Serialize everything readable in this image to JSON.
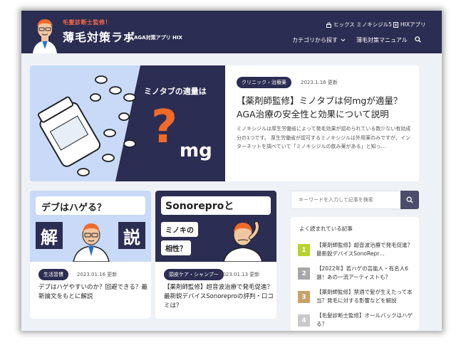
{
  "header": {
    "logo_sub": "毛髪診断士監修！",
    "logo_main": "薄毛対策ラボ",
    "logo_by": "by AGA対策アプリ HIX",
    "top_links": [
      {
        "label": "ヒックス ミノキシジル5",
        "icon": "lock-icon"
      },
      {
        "label": "HIXアプリ",
        "icon": "document-icon"
      }
    ],
    "nav": [
      {
        "label": "カテゴリから探す",
        "icon": "chevron-down-icon"
      },
      {
        "label": "薄毛対策マニュアル"
      }
    ],
    "search_icon": "search-icon"
  },
  "featured": {
    "image_text": {
      "heading": "ミノタブの適量は",
      "question": "?",
      "unit": "mg"
    },
    "tag": "クリニック・治療薬",
    "date": "2023.1.16 更新",
    "title": "【薬剤師監修】ミノタブは何mgが適量？AGA治療の安全性と効果について説明",
    "excerpt": "ミノキシジルは厚生労働省によって発毛効果が認められている数少ない有効成分の1つです。 厚生労働省が認可するミノキシジルは外用薬のみですが、インターネットを調べていて「ミノキシジルの飲み薬がある」と知っ…"
  },
  "cards": [
    {
      "image_text": {
        "line1": "デブはハゲる？",
        "left": "解",
        "right": "説"
      },
      "tag": "生活習慣",
      "date": "2023.01.16 更新",
      "title": "デブはハゲやすいのか？回避できる？最新論文をもとに解説"
    },
    {
      "image_text": {
        "line1": "Sonoreproと",
        "line2": "ミノキの",
        "line3": "相性？"
      },
      "tag": "頭皮ケア・シャンプー",
      "date": "2023.01.13 更新",
      "title": "【薬剤師監修】超音波治療で発毛促進？最新鋭デバイスSonoreproの評判・口コミは？"
    }
  ],
  "sidebar": {
    "search_placeholder": "キーワードを入力して記事を検索",
    "popular_heading": "よく読まれている記事",
    "popular": [
      {
        "rank": "1",
        "color": "#b8d32f",
        "text": "【薬剤師監修】超音波治療で発毛促進？最新鋭デバイスSonoRepr…"
      },
      {
        "rank": "2",
        "color": "#a8a8a8",
        "text": "【2022年】若ハゲの芸能人・有名人6選！あの一流アーティストも？"
      },
      {
        "rank": "3",
        "color": "#c9a16a",
        "text": "【薬剤師監修】禁酒で髪が生えたって本当？発毛に対する影響などを解説"
      },
      {
        "rank": "4",
        "color": "#c9c9c9",
        "text": "【毛髪診断士監修】オールバックはハゲる？"
      }
    ]
  }
}
